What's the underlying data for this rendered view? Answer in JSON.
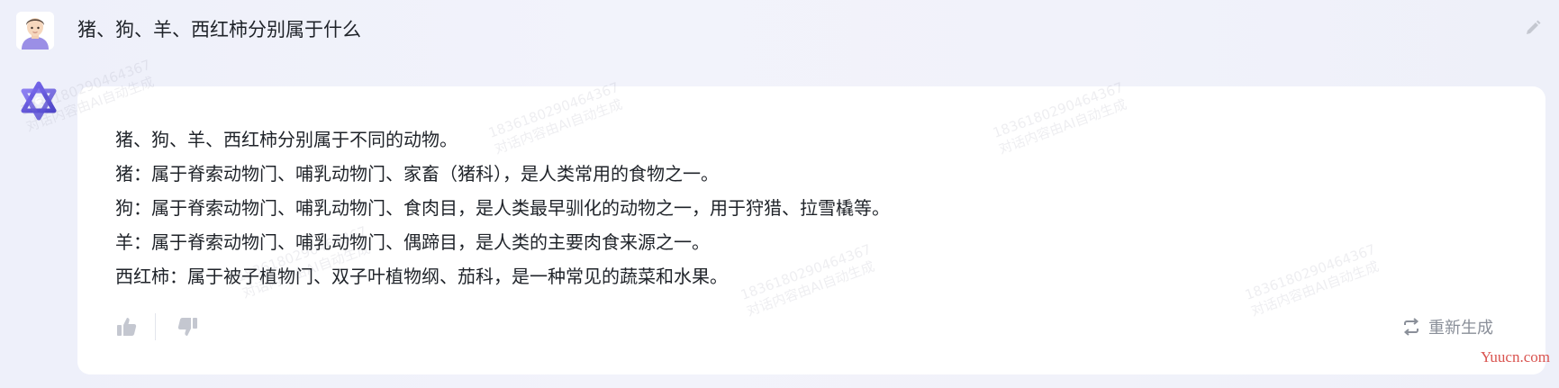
{
  "user": {
    "question": "猪、狗、羊、西红柿分别属于什么"
  },
  "answer": {
    "lines": [
      "猪、狗、羊、西红柿分别属于不同的动物。",
      "猪：属于脊索动物门、哺乳动物门、家畜（猪科），是人类常用的食物之一。",
      "狗：属于脊索动物门、哺乳动物门、食肉目，是人类最早驯化的动物之一，用于狩猎、拉雪橇等。",
      "羊：属于脊索动物门、哺乳动物门、偶蹄目，是人类的主要肉食来源之一。",
      "西红柿：属于被子植物门、双子叶植物纲、茄科，是一种常见的蔬菜和水果。"
    ]
  },
  "actions": {
    "regenerate_label": "重新生成",
    "like_icon": "thumbs-up-icon",
    "dislike_icon": "thumbs-down-icon",
    "regenerate_icon": "regenerate-icon",
    "edit_icon": "pencil-icon"
  },
  "watermark": {
    "line1": "18361802904643​67",
    "line2": "对话内容由AI自动生成"
  },
  "site_badge": "Yuucn.com",
  "colors": {
    "accent": "#6c63d9",
    "text": "#1f2329",
    "muted": "#8a8f99"
  }
}
